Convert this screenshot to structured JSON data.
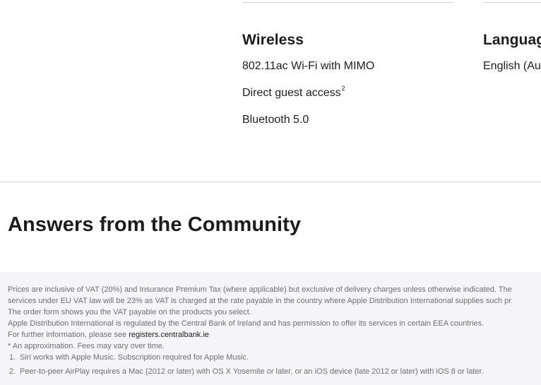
{
  "specs": {
    "wireless": {
      "heading": "Wireless",
      "items": [
        {
          "text": "802.11ac Wi-Fi with MIMO"
        },
        {
          "text": "Direct guest access",
          "sup": "2"
        },
        {
          "text": "Bluetooth 5.0"
        }
      ]
    },
    "language": {
      "heading": "Languag",
      "items": [
        {
          "text": "English (Au"
        }
      ]
    }
  },
  "community": {
    "title": "Answers from the Community"
  },
  "footer": {
    "lines": [
      "Prices are inclusive of VAT (20%) and Insurance Premium Tax (where applicable) but exclusive of delivery charges unless otherwise indicated. The",
      "services under EU VAT law will be 23% as VAT is charged at the rate payable in the country where Apple Distribution International supplies such pr",
      "The order form shows you the VAT payable on the products you select.",
      "Apple Distribution International is regulated by the Central Bank of Ireland and has permission to offer its services in certain EEA countries."
    ],
    "info_prefix": "For further information, please see ",
    "info_link": "registers.centralbank.ie",
    "approximation": "* An approximation. Fees may vary over time.",
    "footnotes": [
      {
        "num": "1.",
        "text": "Siri works with Apple Music. Subscription required for Apple Music."
      },
      {
        "num": "2.",
        "text": "Peer-to-peer AirPlay requires a Mac (2012 or later) with OS X Yosemite or later, or an iOS device (late 2012 or later) with iOS 8 or later."
      }
    ]
  }
}
